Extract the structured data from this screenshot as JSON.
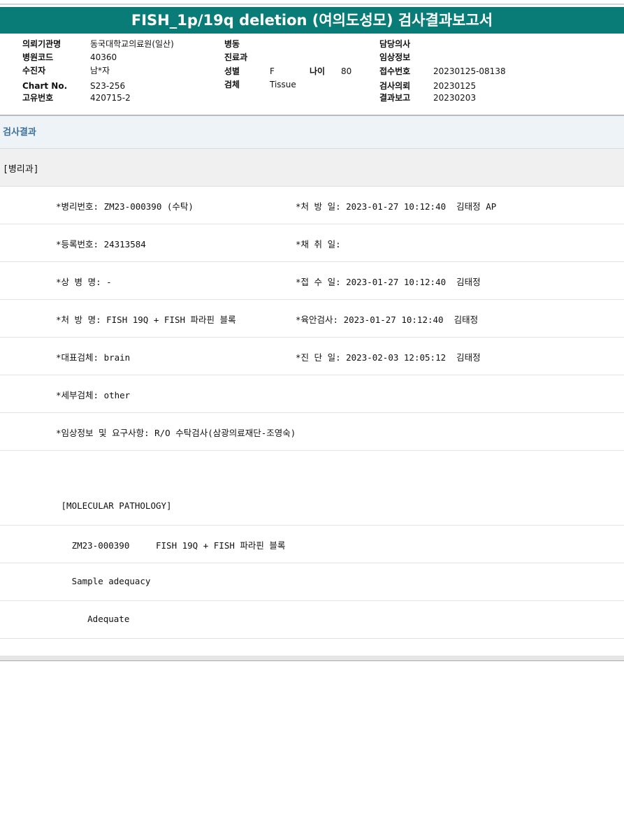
{
  "title": "FISH_1p/19q deletion (여의도성모) 검사결과보고서",
  "header": {
    "col1": [
      {
        "label": "의뢰기관명",
        "value": "동국대학교의료원(일산)"
      },
      {
        "label": "병원코드",
        "value": "40360"
      },
      {
        "label": "수진자",
        "value": "남*자"
      },
      {
        "label": "Chart No.",
        "value": "S23-256"
      },
      {
        "label": "고유번호",
        "value": "420715-2"
      }
    ],
    "col2": {
      "ward_label": "병동",
      "ward_value": "",
      "dept_label": "진료과",
      "dept_value": "",
      "sex_label": "성별",
      "sex_value": "F",
      "age_label": "나이",
      "age_value": "80",
      "specimen_label": "검체",
      "specimen_value": "Tissue"
    },
    "col3": [
      {
        "label": "담당의사",
        "value": ""
      },
      {
        "label": "임상정보",
        "value": ""
      },
      {
        "label": "접수번호",
        "value": "20230125-08138"
      },
      {
        "label": "검사의뢰",
        "value": "20230125"
      },
      {
        "label": "결과보고",
        "value": "20230203"
      }
    ]
  },
  "section_title": "검사결과",
  "dept_label": "[병리과]",
  "rows": [
    {
      "left": "*병리번호: ZM23-000390 (수탁)",
      "right": "*처 방 일: 2023-01-27 10:12:40  김태정 AP"
    },
    {
      "left": "*등록번호: 24313584",
      "right": "*채 취 일:"
    },
    {
      "left": "*상 병 명: -",
      "right": "*접 수 일: 2023-01-27 10:12:40  김태정"
    },
    {
      "left": "*처 방 명: FISH 19Q + FISH 파라핀 블록",
      "right": "*육안검사: 2023-01-27 10:12:40  김태정"
    },
    {
      "left": "*대표검체: brain",
      "right": "*진 단 일: 2023-02-03 12:05:12  김태정"
    },
    {
      "left": "*세부검체: other",
      "right": ""
    },
    {
      "left": "*임상정보 및 요구사항: R/O 수탁검사(삼광의료재단-조영숙)",
      "right": ""
    },
    {
      "left": "",
      "right": ""
    },
    {
      "left": " [MOLECULAR PATHOLOGY]",
      "right": ""
    },
    {
      "left": "   ZM23-000390     FISH 19Q + FISH 파라핀 블록",
      "right": ""
    },
    {
      "left": "   Sample adequacy",
      "right": ""
    },
    {
      "left": "      Adequate",
      "right": ""
    }
  ]
}
